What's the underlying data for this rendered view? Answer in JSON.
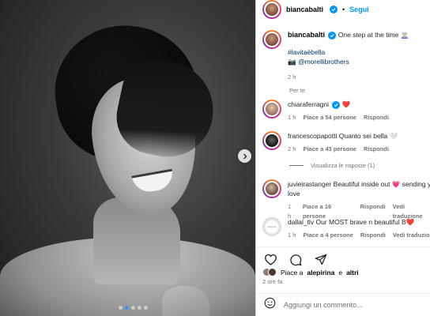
{
  "media": {
    "carousel": {
      "dot_count": 5,
      "active_index": 1
    },
    "next_icon": "chevron-right-icon"
  },
  "post": {
    "username": "biancabalti",
    "verified": true,
    "separator": "•",
    "follow_label": "Segui",
    "caption": {
      "username": "biancabalti",
      "text": "One step at the time",
      "emoji": "🧝🏻‍♀️",
      "hashtag": "#lavitaèbella",
      "credit_icon": "📷",
      "credit_mention": "@morellibrothers",
      "time": "2 h"
    },
    "translation_label": "Per te"
  },
  "comments": [
    {
      "username": "chiaraferragni",
      "verified": true,
      "text": "❤️",
      "time": "1 h",
      "likes": "Piace a 54 persone",
      "reply_label": "Rispondi"
    },
    {
      "username": "francescopapotti",
      "verified": false,
      "text": "Quanto sei bella 🤍",
      "time": "2 h",
      "likes": "Piace a 43 persone",
      "reply_label": "Rispondi"
    },
    {
      "username": "juvieirastanger",
      "verified": false,
      "text": "Beautiful inside out 💗 sending y love",
      "time": "1 h",
      "likes": "Piace a 16 persone",
      "reply_label": "Rispondi",
      "translate_label": "Vedi traduzione"
    },
    {
      "username": "dallal_tlv",
      "verified": false,
      "text": "Our MOST brave n beautiful B❤️",
      "time": "1 h",
      "likes": "Piace a 4 persone",
      "reply_label": "Rispondi",
      "translate_label": "Vedi traduzione"
    }
  ],
  "replies_label": "Visualizza le risposte (1)",
  "likes_summary": {
    "prefix": "Piace a",
    "user": "alepirina",
    "and": "e",
    "others": "altri"
  },
  "posted_time": "2 ore fa",
  "comment_input": {
    "placeholder": "Aggiungi un commento..."
  },
  "colors": {
    "accent": "#0095f6",
    "like_red": "#ed4956",
    "muted": "#737373"
  }
}
